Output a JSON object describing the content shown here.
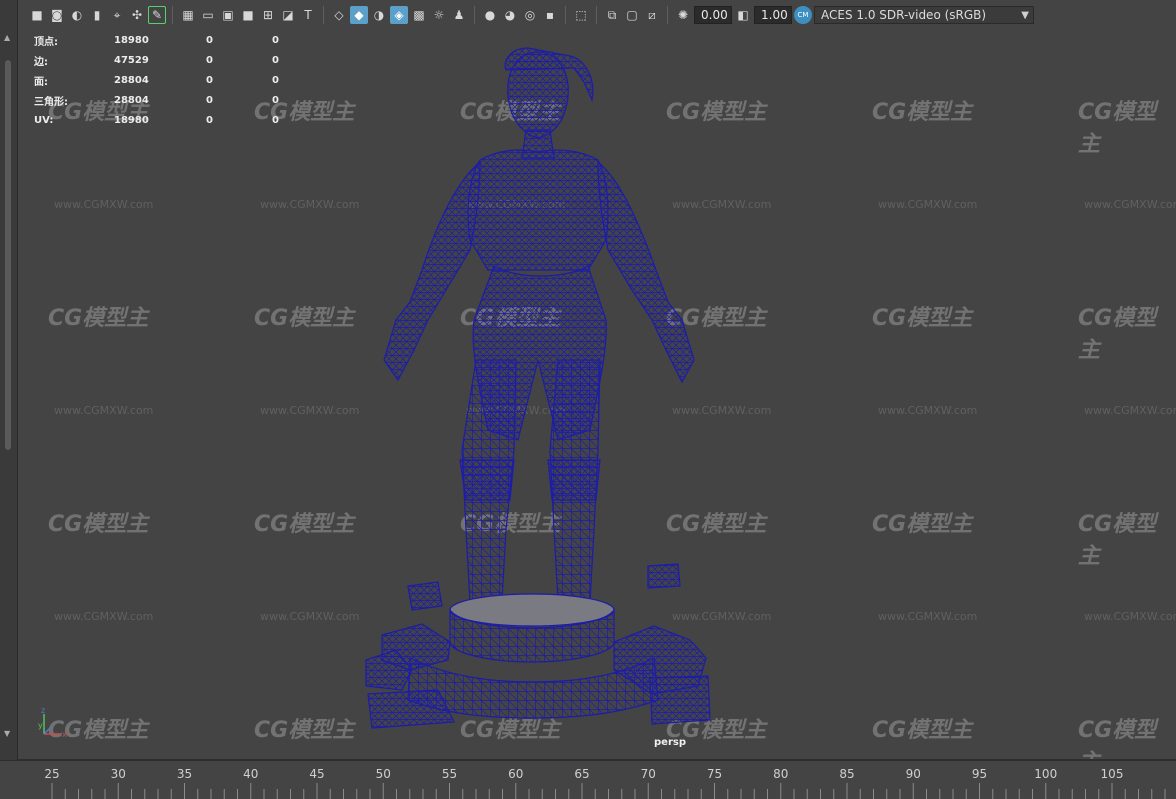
{
  "toolbar": {
    "exposure_value": "0.00",
    "gamma_value": "1.00",
    "color_space": "ACES 1.0 SDR-video (sRGB)",
    "cm_badge": "CM",
    "icons": [
      "camera-icon",
      "camera-attr-icon",
      "bookmark-icon",
      "image-plane-icon",
      "grid-icon",
      "film-gate-icon",
      "resolution-gate-icon",
      "gate-mask-icon",
      "field-chart-icon",
      "safe-action-icon",
      "safe-title-icon",
      "wireframe-icon",
      "smooth-shade-icon",
      "default-material-icon",
      "wireframe-on-shaded-icon",
      "textured-icon",
      "lights-icon",
      "shadows-icon",
      "ambient-occlusion-icon",
      "motion-blur-icon",
      "anti-alias-icon",
      "isolate-select-icon",
      "xray-icon",
      "xray-joints-icon",
      "xray-components-icon",
      "exposure-icon",
      "gamma-icon",
      "color-management-icon"
    ]
  },
  "hud": {
    "rows": [
      {
        "label": "顶点:",
        "v1": "18980",
        "v2": "0",
        "v3": "0"
      },
      {
        "label": "边:",
        "v1": "47529",
        "v2": "0",
        "v3": "0"
      },
      {
        "label": "面:",
        "v1": "28804",
        "v2": "0",
        "v3": "0"
      },
      {
        "label": "三角形:",
        "v1": "28804",
        "v2": "0",
        "v3": "0"
      },
      {
        "label": "UV:",
        "v1": "18980",
        "v2": "0",
        "v3": "0"
      }
    ]
  },
  "viewport": {
    "camera": "persp",
    "watermark_logo": "CG模型主",
    "watermark_url": "www.CGMXW.com",
    "wire_color": "#1c1ca8",
    "background_color": "#444444",
    "axis": {
      "x": "x",
      "y": "y",
      "z": "z"
    }
  },
  "timeline": {
    "ticks": [
      "25",
      "30",
      "35",
      "40",
      "45",
      "50",
      "55",
      "60",
      "65",
      "70",
      "75",
      "80",
      "85",
      "90",
      "95",
      "100",
      "105"
    ]
  }
}
